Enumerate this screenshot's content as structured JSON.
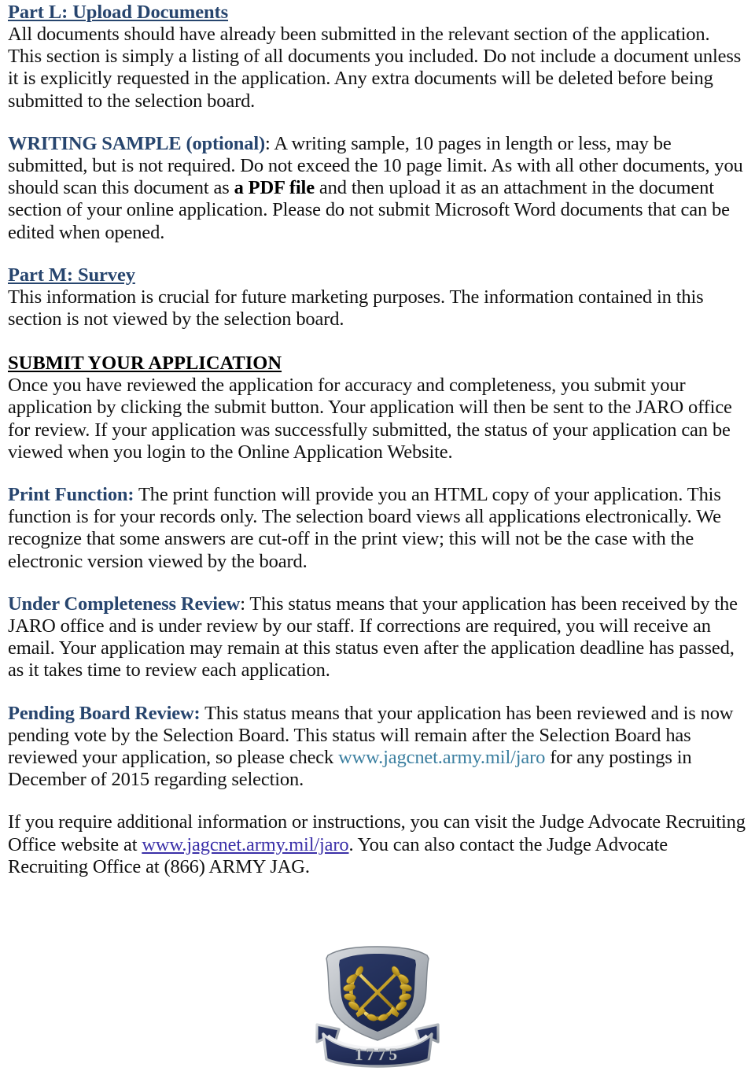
{
  "document": {
    "sections": [
      {
        "id": "part-l",
        "heading": "Part L:  Upload Documents",
        "heading_style": "blue-underline",
        "lines": [
          "All documents should have already been submitted in the relevant section of the application.",
          "This section is simply a listing of all documents you included.  Do not include a document unless",
          "it is explicitly requested in the application.  Any extra documents will be deleted before being",
          "submitted to the selection board."
        ]
      },
      {
        "id": "writing-sample",
        "lead": "WRITING SAMPLE (optional)",
        "lead_style": "blue-bold",
        "body_before_bold": ": A writing sample, 10 pages in length or less, may be submitted, but is not required.  Do not exceed the 10 page limit.  As with all other documents, you should scan this document as ",
        "bold_phrase": "a PDF file",
        "body_after_bold": " and then upload it as an attachment in the document section of your online application.   Please do not submit Microsoft Word documents that can be edited when opened."
      },
      {
        "id": "part-m",
        "heading": "Part M:  Survey",
        "heading_style": "blue-underline",
        "lines": [
          "This information is crucial for future marketing purposes.  The information contained in this",
          "section is not viewed by the selection board."
        ]
      },
      {
        "id": "submit-application",
        "heading": "SUBMIT YOUR APPLICATION",
        "heading_style": "black-underline",
        "lines": [
          "Once you have reviewed the application for accuracy and completeness, you submit your",
          "application by clicking the submit button.  Your application will then be sent to the JARO office",
          "for review.  If your application was successfully submitted, the status of your application can be",
          "viewed when you login to the Online Application Website."
        ]
      },
      {
        "id": "print-function",
        "lead": "Print Function:",
        "lead_style": "blue-bold",
        "body": "  The print function will provide you an HTML copy of your application.  This function is for your records only.  The selection board views all applications electronically.  We recognize that some answers are cut-off in the print view; this will not be the case with the electronic version viewed by the board."
      },
      {
        "id": "under-completeness-review",
        "lead": "Under Completeness Review",
        "lead_style": "blue-bold",
        "body": ": This status means that your application has been received by the JARO office and is under review by our staff.  If corrections are required, you will receive an email. Your application may remain at this status even after the application deadline has passed, as it takes time to review each application."
      },
      {
        "id": "pending-board-review",
        "lead": "Pending Board Review:",
        "lead_style": "blue-bold",
        "body_before_link": "  This status means that your application has been reviewed and is now pending vote by the Selection Board. This status will remain after the Selection Board has reviewed your application, so please check ",
        "link_text": "www.jagcnet.army.mil/jaro",
        "link_style": "teal",
        "body_after_link": " for any postings in December of 2015 regarding selection."
      },
      {
        "id": "contact-info",
        "body_before_link": "If you require additional information or instructions, you can visit the Judge Advocate Recruiting Office website at ",
        "link_text": "www.jagcnet.army.mil/jaro",
        "link_style": "purple-underline",
        "body_after_link": ".  You can also contact the Judge Advocate Recruiting Office at (866) ARMY JAG."
      }
    ]
  },
  "emblem": {
    "name": "jag-corps-regimental-insignia",
    "banner_text": "1775",
    "colors": {
      "shield_navy": "#23305C",
      "border_silver": "#B8BCC2",
      "border_silver_dark": "#8E949C",
      "gold": "#C9A227",
      "gold_light": "#E6C95C",
      "gold_dark": "#9C7B15",
      "banner_navy": "#26335E",
      "banner_text_silver": "#C6CAD0"
    }
  }
}
